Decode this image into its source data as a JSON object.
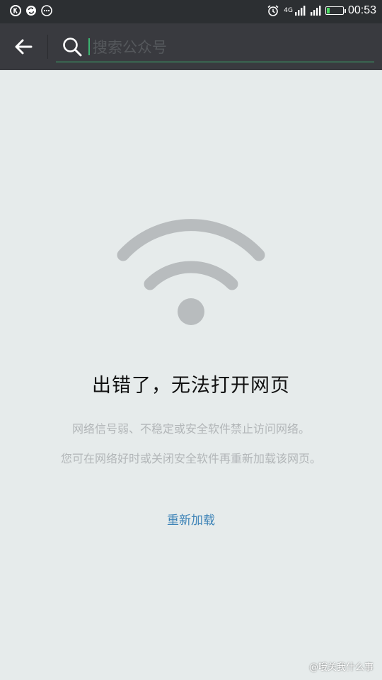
{
  "status_bar": {
    "network_label": "4G",
    "time": "00:53",
    "battery_level": 0.15,
    "left_icons": [
      "k-app-icon",
      "sync-icon",
      "more-dots-icon"
    ],
    "right_icons": [
      "alarm-icon",
      "signal-4g-icon",
      "signal-icon",
      "battery-icon"
    ]
  },
  "toolbar": {
    "search_placeholder": "搜索公众号",
    "search_value": ""
  },
  "error": {
    "title": "出错了，无法打开网页",
    "message_1": "网络信号弱、不稳定或安全软件禁止访问网络。",
    "message_2": "您可在网络好时或关闭安全软件再重新加载该网页。",
    "reload_label": "重新加载"
  },
  "watermark": {
    "text": "@哦关我什么事"
  },
  "colors": {
    "status_bar_bg": "#2c2f32",
    "toolbar_bg": "#393a3f",
    "page_bg": "#e6ebeb",
    "accent_green": "#3cb371",
    "link_blue": "#3d83b7",
    "wifi_gray": "#b8bcbe"
  }
}
